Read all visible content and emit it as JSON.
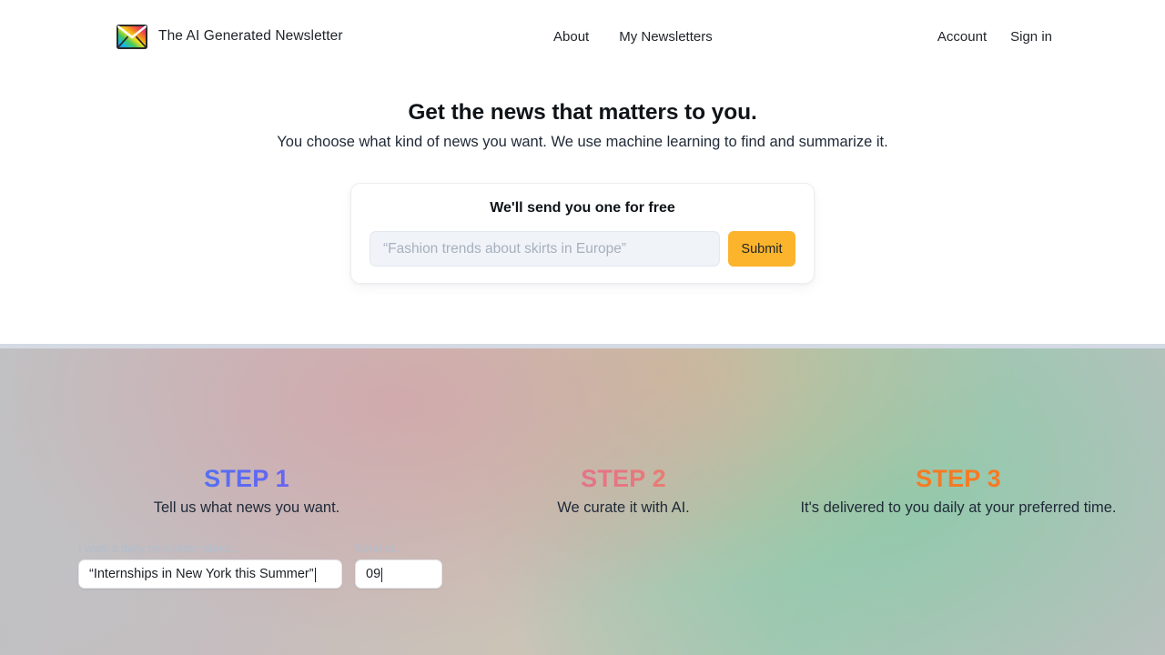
{
  "brand": {
    "name": "The AI Generated Newsletter",
    "logo_icon": "rainbow-envelope-icon"
  },
  "nav": {
    "center_links": [
      {
        "label": "About"
      },
      {
        "label": "My Newsletters"
      }
    ],
    "right_links": [
      {
        "label": "Account"
      },
      {
        "label": "Sign in"
      }
    ]
  },
  "hero": {
    "title": "Get the news that matters to you.",
    "subtitle": "You choose what kind of news you want. We use machine learning to find and summarize it."
  },
  "signup": {
    "title": "We'll send you one for free",
    "input_value": "",
    "input_placeholder": "“Fashion trends about skirts in Europe”",
    "submit_label": "Submit",
    "submit_color": "#fbb42c"
  },
  "steps": [
    {
      "title": "STEP 1",
      "description": "Tell us what news you want.",
      "gradient_from": "#3b82f6",
      "gradient_to": "#a855f7"
    },
    {
      "title": "STEP 2",
      "description": "We curate it with AI.",
      "gradient_from": "#d76fa8",
      "gradient_to": "#ee9445"
    },
    {
      "title": "STEP 3",
      "description": "It's delivered to you daily at your preferred time.",
      "gradient_from": "#f47b25",
      "gradient_to": "#f47b25"
    }
  ],
  "mini_form": {
    "topic_label": "I want a daily newsletter about...",
    "topic_value": "“Internships in New York this Summer”",
    "time_label": "Send at...",
    "time_value": "09"
  }
}
